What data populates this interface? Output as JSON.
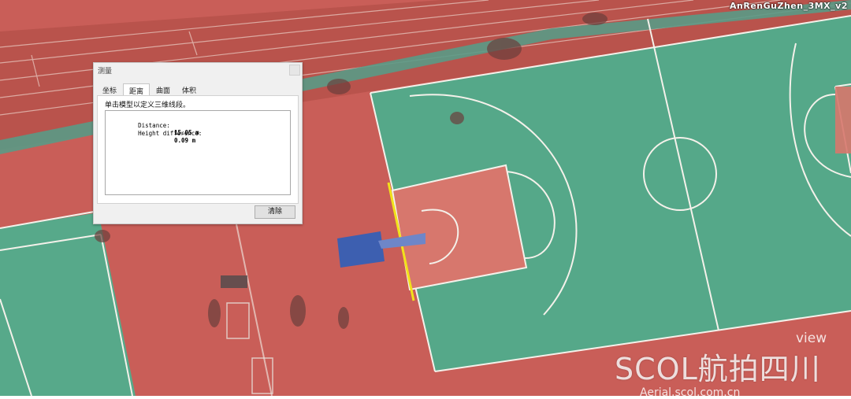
{
  "viewer": {
    "model_title": "AnRenGuZhen_3MX_v2"
  },
  "measure_dialog": {
    "title": "测量",
    "tabs": [
      "坐标",
      "距离",
      "曲面",
      "体积"
    ],
    "active_tab": "距离",
    "instruction": "单击模型以定义三维线段。",
    "results": [
      {
        "label": "Distance:",
        "value": "15.05 m"
      },
      {
        "label": "Height difference:",
        "value": "0.09 m"
      }
    ],
    "clear_label": "清除"
  },
  "measurement": {
    "line_color": "#f2e21a"
  },
  "watermark": {
    "main": "SCOL航拍四川",
    "view": "view",
    "sub": "Aerial.scol.com.cn"
  },
  "colors": {
    "track_red": "#c55a55",
    "court_green": "#55a889",
    "court_red": "#d7776d",
    "line_white": "#f4f1ea",
    "tarp_blue": "#3d5fb0"
  }
}
